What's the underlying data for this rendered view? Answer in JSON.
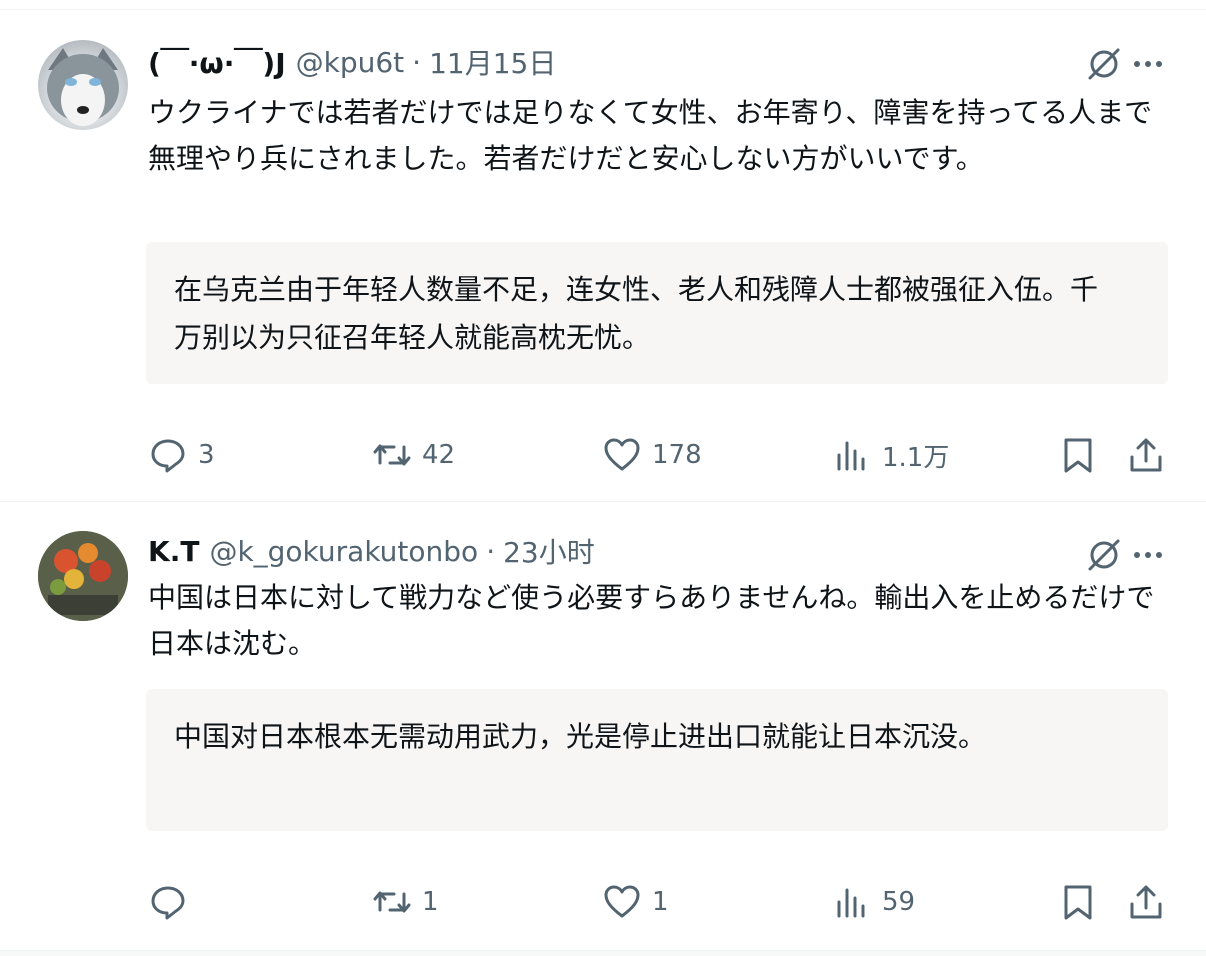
{
  "posts": [
    {
      "display_name": "(￣·ω·￣)J",
      "handle": "@kpu6t",
      "separator": "·",
      "time": "11月15日",
      "avatar_icon": "husky-avatar",
      "text": "ウクライナでは若者だけでは足りなくて女性、お年寄り、障害を持ってる人まで無理やり兵にされました。若者だけだと安心しない方がいいです。",
      "translation": "在乌克兰由于年轻人数量不足，连女性、老人和残障人士都被强征入伍。千万别以为只征召年轻人就能高枕无忧。",
      "stats": {
        "replies": "3",
        "reposts": "42",
        "likes": "178",
        "views": "1.1万"
      }
    },
    {
      "display_name": "K.T",
      "handle": "@k_gokurakutonbo",
      "separator": "·",
      "time": "23小时",
      "avatar_icon": "flowers-avatar",
      "text": "中国は日本に対して戦力など使う必要すらありませんね。輸出入を止めるだけで日本は沈む。",
      "translation": "中国对日本根本无需动用武力，光是停止进出口就能让日本沉没。",
      "stats": {
        "replies": "",
        "reposts": "1",
        "likes": "1",
        "views": "59"
      }
    }
  ],
  "icons": {
    "grok": "grok-icon",
    "more": "more-icon",
    "reply": "reply-icon",
    "repost": "repost-icon",
    "like": "like-icon",
    "views": "views-icon",
    "bookmark": "bookmark-icon",
    "share": "share-icon"
  },
  "colors": {
    "text": "#0f1419",
    "secondary": "#536471",
    "translation_bg": "#f7f6f4",
    "divider": "#eff3f4"
  }
}
